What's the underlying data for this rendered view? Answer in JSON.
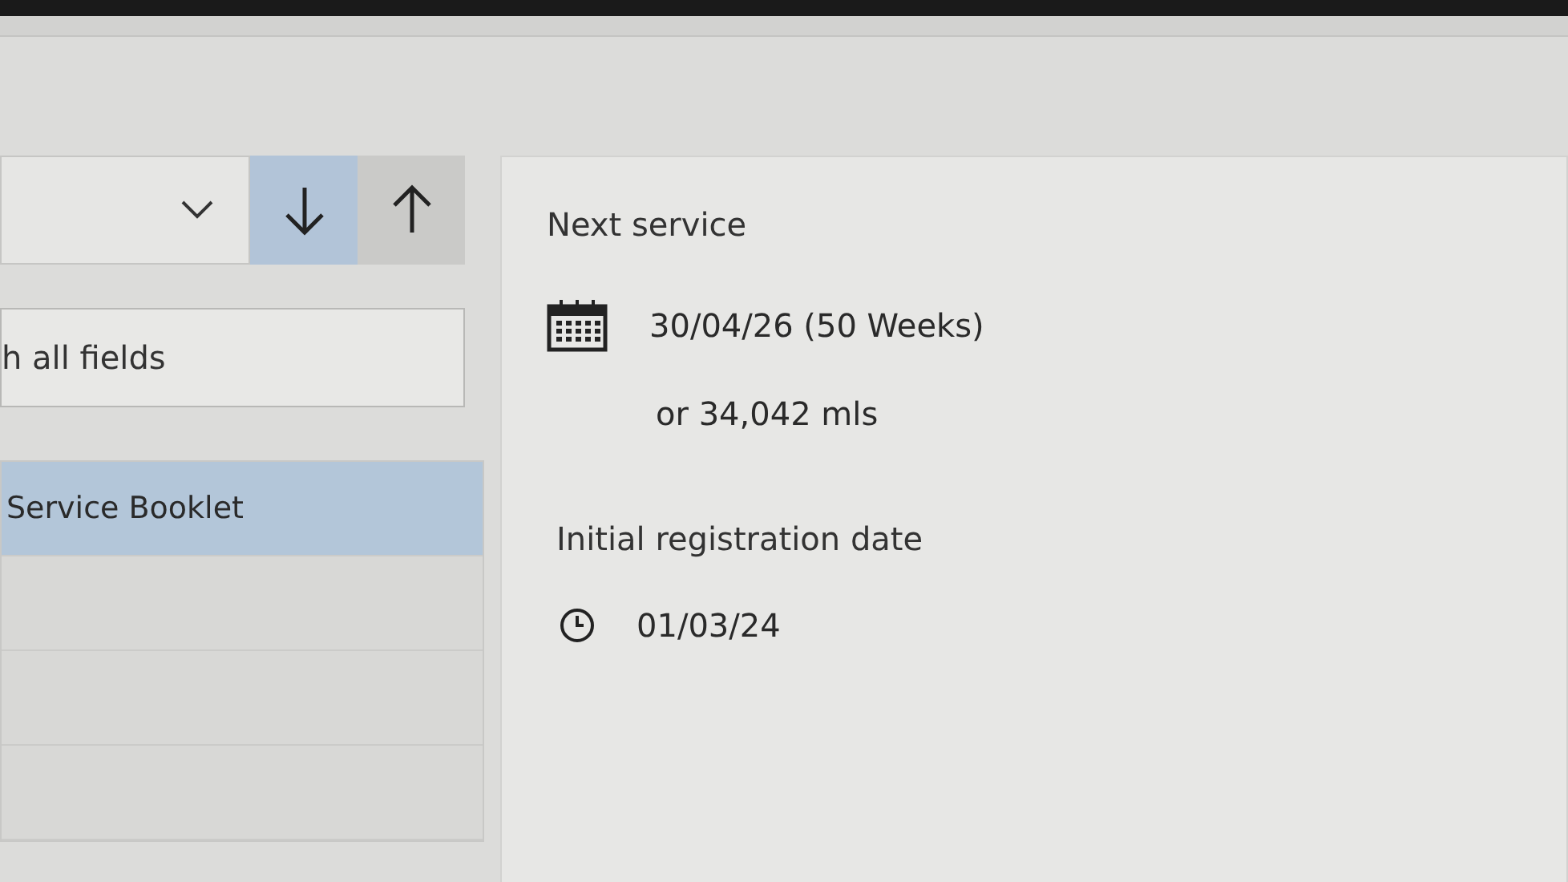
{
  "sort_buttons": [
    {
      "kind": "down",
      "selected": true
    },
    {
      "kind": "up",
      "selected": false
    }
  ],
  "search": {
    "value": "h all fields"
  },
  "list": [
    {
      "label": "Service Booklet",
      "selected": true
    },
    {
      "selected": false
    },
    {
      "selected": false
    },
    {
      "selected": false
    }
  ],
  "details": {
    "next_service": {
      "title": "Next service",
      "date": "30/04/26 (50 Weeks)",
      "mileage": "or 34,042 mls"
    },
    "registration": {
      "title": "Initial registration date",
      "date": "01/03/24"
    }
  }
}
